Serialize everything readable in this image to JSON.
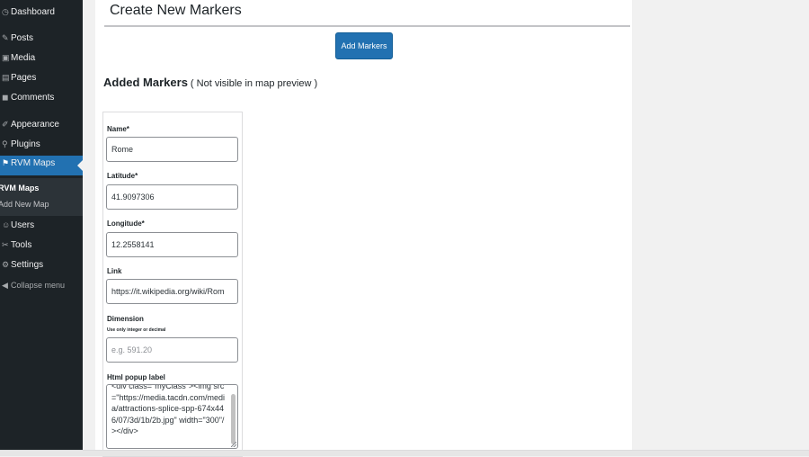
{
  "sidebar": {
    "items": [
      {
        "label": "Dashboard",
        "icon": "dashboard-icon"
      },
      {
        "label": "Posts",
        "icon": "posts-icon"
      },
      {
        "label": "Media",
        "icon": "media-icon"
      },
      {
        "label": "Pages",
        "icon": "pages-icon"
      },
      {
        "label": "Comments",
        "icon": "comments-icon"
      },
      {
        "label": "Appearance",
        "icon": "appearance-icon"
      },
      {
        "label": "Plugins",
        "icon": "plugins-icon"
      },
      {
        "label": "RVM Maps",
        "icon": "map-icon",
        "active": true
      },
      {
        "label": "Users",
        "icon": "users-icon"
      },
      {
        "label": "Tools",
        "icon": "tools-icon"
      },
      {
        "label": "Settings",
        "icon": "settings-icon"
      },
      {
        "label": "Collapse menu",
        "icon": "collapse-icon"
      }
    ],
    "submenu": [
      "RVM Maps",
      "Add New Map"
    ]
  },
  "main": {
    "title": "Create New Markers",
    "add_button": "Add Markers",
    "added_heading": "Added Markers",
    "added_note": "( Not visible in map preview )"
  },
  "marker_form": {
    "name_label": "Name*",
    "name_value": "Rome",
    "latitude_label": "Latitude*",
    "latitude_value": "41.9097306",
    "longitude_label": "Longitude*",
    "longitude_value": "12.2558141",
    "link_label": "Link",
    "link_value": "https://it.wikipedia.org/wiki/Rom",
    "dimension_label": "Dimension",
    "dimension_hint": "Use only integer or decimal",
    "dimension_placeholder": "e.g. 591.20",
    "popup_label": "Html popup label",
    "popup_value": "<div class=\"myClass\"><img src=\"https://media.tacdn.com/media/attractions-splice-spp-674x446/07/3d/1b/2b.jpg\" width=\"300\"/></div>"
  },
  "colors": {
    "sidebar_bg": "#1d2327",
    "accent": "#2271b1",
    "panel_bg": "#ffffff",
    "page_bg": "#f1f1f1"
  }
}
